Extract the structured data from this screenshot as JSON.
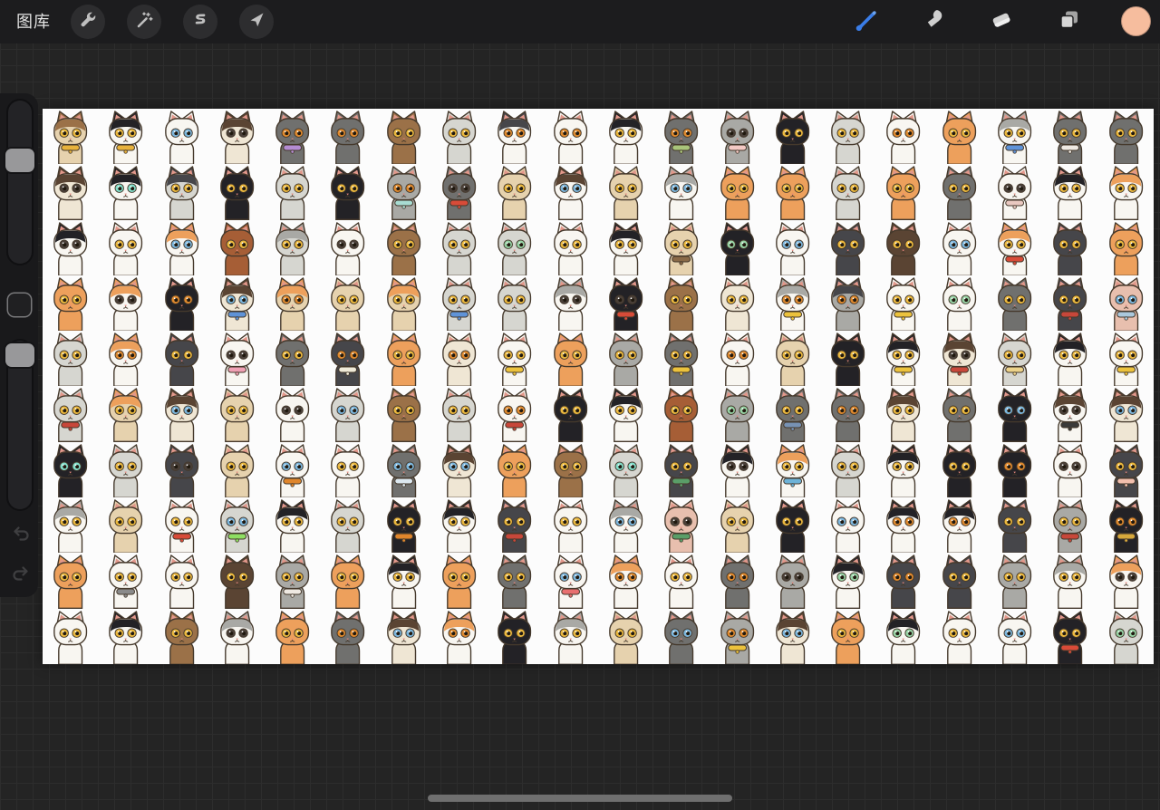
{
  "topbar": {
    "gallery_label": "图库"
  },
  "colors": {
    "accent": "#3a7de8",
    "swatch": "#f6bd9e",
    "topbar-bg": "#1c1c1e",
    "bg": "#242424",
    "grid-line": "#2d2d2d",
    "canvas-bg": "#fcfcfc",
    "icon": "#c4c4c4",
    "circle": "#2d2d2f",
    "panel": "#19191b",
    "track": "#232326",
    "handle": "#98989a",
    "indicator": "#6f6f6f"
  },
  "canvas": {
    "columns": 20,
    "rows": 10,
    "cat_count": 200
  },
  "cats": {
    "outline": "#45392c",
    "ear_inner": "#e2988b",
    "nose": "#e2857c",
    "palette": {
      "W": "#f8f6f1",
      "S": "#efe6d4",
      "C": "#e6d2ae",
      "L": "#d6d6d0",
      "G": "#a9a9a5",
      "D": "#70706e",
      "E": "#46464a",
      "B": "#232226",
      "O": "#eda05c",
      "T": "#9b7148",
      "N": "#5a4433",
      "R": "#a65e36",
      "P": "#e8bfae"
    },
    "eyes": {
      "y": "#ecb93e",
      "o": "#e08a2e",
      "b": "#7cb7de",
      "g": "#97d3a5",
      "t": "#83dfcb",
      "k": "#4a4039"
    },
    "items": [
      [
        "C",
        "y",
        "T",
        "#e8b23c"
      ],
      [
        "W",
        "y",
        "B",
        "#e8b23c"
      ],
      [
        "W",
        "b",
        null,
        null
      ],
      [
        "S",
        "k",
        "N",
        null
      ],
      [
        "D",
        "o",
        null,
        "#b48cd2"
      ],
      [
        "D",
        "o",
        null,
        null
      ],
      [
        "T",
        "y",
        null,
        null
      ],
      [
        "L",
        "y",
        null,
        null
      ],
      [
        "W",
        "o",
        "E",
        null
      ],
      [
        "W",
        "o",
        null,
        null
      ],
      [
        "W",
        "y",
        "B",
        null
      ],
      [
        "D",
        "o",
        null,
        "#a9c57a"
      ],
      [
        "G",
        "k",
        null,
        "#f4c9c4"
      ],
      [
        "B",
        "y",
        null,
        null
      ],
      [
        "L",
        "y",
        null,
        null
      ],
      [
        "W",
        "o",
        null,
        null
      ],
      [
        "O",
        "y",
        null,
        null
      ],
      [
        "W",
        "y",
        "G",
        "#5f93d8"
      ],
      [
        "D",
        "y",
        null,
        "#efe9e2"
      ],
      [
        "D",
        "y",
        null,
        null
      ],
      [
        "S",
        "k",
        "N",
        null
      ],
      [
        "W",
        "t",
        "B",
        null
      ],
      [
        "L",
        "y",
        "E",
        null
      ],
      [
        "B",
        "y",
        null,
        null
      ],
      [
        "L",
        "y",
        null,
        null
      ],
      [
        "B",
        "y",
        null,
        null
      ],
      [
        "G",
        "o",
        null,
        "#a8dcd2"
      ],
      [
        "D",
        "k",
        null,
        "#d84b38"
      ],
      [
        "C",
        "y",
        null,
        null
      ],
      [
        "W",
        "b",
        "N",
        null
      ],
      [
        "C",
        "y",
        null,
        null
      ],
      [
        "W",
        "b",
        "G",
        null
      ],
      [
        "O",
        "y",
        null,
        null
      ],
      [
        "O",
        "y",
        null,
        null
      ],
      [
        "L",
        "y",
        null,
        null
      ],
      [
        "O",
        "y",
        null,
        null
      ],
      [
        "D",
        "y",
        null,
        null
      ],
      [
        "W",
        "k",
        null,
        "#e9c8c0"
      ],
      [
        "W",
        "y",
        "B",
        null
      ],
      [
        "W",
        "y",
        "O",
        null
      ],
      [
        "W",
        "k",
        "B",
        null
      ],
      [
        "W",
        "y",
        null,
        null
      ],
      [
        "W",
        "b",
        "O",
        null
      ],
      [
        "R",
        "y",
        null,
        null
      ],
      [
        "L",
        "y",
        "G",
        null
      ],
      [
        "W",
        "k",
        null,
        null
      ],
      [
        "T",
        "y",
        null,
        null
      ],
      [
        "L",
        "y",
        null,
        null
      ],
      [
        "L",
        "g",
        null,
        null
      ],
      [
        "W",
        "y",
        null,
        null
      ],
      [
        "W",
        "y",
        "B",
        null
      ],
      [
        "C",
        "y",
        null,
        "#8a6a48"
      ],
      [
        "B",
        "g",
        null,
        null
      ],
      [
        "W",
        "b",
        null,
        null
      ],
      [
        "E",
        "y",
        null,
        null
      ],
      [
        "N",
        "y",
        null,
        null
      ],
      [
        "W",
        "b",
        null,
        null
      ],
      [
        "W",
        "y",
        "O",
        "#d84b38"
      ],
      [
        "E",
        "y",
        null,
        null
      ],
      [
        "O",
        "y",
        null,
        null
      ],
      [
        "O",
        "y",
        null,
        null
      ],
      [
        "W",
        "k",
        "O",
        null
      ],
      [
        "B",
        "o",
        null,
        null
      ],
      [
        "S",
        "b",
        "N",
        "#5f93d8"
      ],
      [
        "C",
        "o",
        "O",
        null
      ],
      [
        "C",
        "y",
        null,
        null
      ],
      [
        "C",
        "y",
        "O",
        null
      ],
      [
        "L",
        "y",
        null,
        "#5f93d8"
      ],
      [
        "L",
        "y",
        null,
        null
      ],
      [
        "W",
        "k",
        "G",
        null
      ],
      [
        "B",
        "k",
        null,
        "#d84b38"
      ],
      [
        "T",
        "y",
        null,
        null
      ],
      [
        "S",
        "y",
        null,
        null
      ],
      [
        "W",
        "o",
        "G",
        "#ecc23c"
      ],
      [
        "G",
        "o",
        "E",
        null
      ],
      [
        "W",
        "y",
        null,
        "#ecc23c"
      ],
      [
        "W",
        "g",
        null,
        null
      ],
      [
        "D",
        "y",
        null,
        null
      ],
      [
        "E",
        "y",
        null,
        "#c8473a"
      ],
      [
        "P",
        "b",
        null,
        "#aac8dc"
      ],
      [
        "L",
        "y",
        null,
        null
      ],
      [
        "W",
        "o",
        "O",
        null
      ],
      [
        "E",
        "y",
        null,
        null
      ],
      [
        "W",
        "k",
        null,
        "#f0a0b4"
      ],
      [
        "D",
        "y",
        null,
        null
      ],
      [
        "E",
        "o",
        null,
        "#f0ead8"
      ],
      [
        "O",
        "y",
        null,
        null
      ],
      [
        "S",
        "o",
        null,
        null
      ],
      [
        "W",
        "y",
        null,
        "#ecc23c"
      ],
      [
        "O",
        "y",
        null,
        null
      ],
      [
        "G",
        "y",
        null,
        null
      ],
      [
        "D",
        "y",
        null,
        "#ecc23c"
      ],
      [
        "W",
        "o",
        null,
        null
      ],
      [
        "C",
        "y",
        null,
        null
      ],
      [
        "B",
        "y",
        null,
        null
      ],
      [
        "W",
        "y",
        "B",
        "#ecc23c"
      ],
      [
        "S",
        "k",
        "N",
        "#c8473a"
      ],
      [
        "L",
        "y",
        null,
        "#ecd28a"
      ],
      [
        "W",
        "y",
        "B",
        null
      ],
      [
        "W",
        "y",
        null,
        "#ecc23c"
      ],
      [
        "L",
        "y",
        null,
        "#c8473a"
      ],
      [
        "C",
        "y",
        "O",
        null
      ],
      [
        "S",
        "b",
        "N",
        null
      ],
      [
        "C",
        "y",
        null,
        null
      ],
      [
        "W",
        "k",
        null,
        null
      ],
      [
        "L",
        "b",
        null,
        null
      ],
      [
        "T",
        "y",
        null,
        null
      ],
      [
        "L",
        "y",
        null,
        null
      ],
      [
        "W",
        "o",
        null,
        "#c8473a"
      ],
      [
        "B",
        "y",
        null,
        null
      ],
      [
        "W",
        "y",
        "B",
        null
      ],
      [
        "R",
        "y",
        null,
        null
      ],
      [
        "G",
        "g",
        null,
        null
      ],
      [
        "D",
        "y",
        null,
        "#7792b4"
      ],
      [
        "D",
        "o",
        null,
        null
      ],
      [
        "S",
        "y",
        "N",
        null
      ],
      [
        "D",
        "y",
        null,
        null
      ],
      [
        "B",
        "b",
        null,
        null
      ],
      [
        "W",
        "k",
        "N",
        "#3a3a3a"
      ],
      [
        "S",
        "b",
        "N",
        null
      ],
      [
        "B",
        "t",
        null,
        null
      ],
      [
        "L",
        "y",
        null,
        null
      ],
      [
        "E",
        "k",
        null,
        null
      ],
      [
        "C",
        "y",
        null,
        null
      ],
      [
        "W",
        "b",
        null,
        "#e0862c"
      ],
      [
        "W",
        "y",
        null,
        null
      ],
      [
        "D",
        "b",
        null,
        "#dce8f0"
      ],
      [
        "S",
        "b",
        "N",
        null
      ],
      [
        "O",
        "y",
        null,
        null
      ],
      [
        "T",
        "y",
        null,
        null
      ],
      [
        "L",
        "t",
        null,
        null
      ],
      [
        "E",
        "y",
        null,
        "#5a9e68"
      ],
      [
        "W",
        "k",
        "B",
        null
      ],
      [
        "W",
        "y",
        "O",
        "#6db3d8"
      ],
      [
        "L",
        "y",
        null,
        null
      ],
      [
        "W",
        "y",
        "B",
        null
      ],
      [
        "B",
        "y",
        null,
        null
      ],
      [
        "B",
        "o",
        null,
        null
      ],
      [
        "W",
        "k",
        null,
        null
      ],
      [
        "E",
        "y",
        null,
        "#f2bfae"
      ],
      [
        "W",
        "y",
        "G",
        null
      ],
      [
        "C",
        "y",
        null,
        null
      ],
      [
        "W",
        "y",
        null,
        "#d84b38"
      ],
      [
        "L",
        "b",
        null,
        "#8ede62"
      ],
      [
        "W",
        "y",
        "B",
        null
      ],
      [
        "L",
        "y",
        null,
        null
      ],
      [
        "B",
        "y",
        null,
        "#e0862c"
      ],
      [
        "W",
        "y",
        "B",
        null
      ],
      [
        "E",
        "y",
        null,
        "#c8473a"
      ],
      [
        "W",
        "y",
        null,
        null
      ],
      [
        "W",
        "b",
        "G",
        null
      ],
      [
        "P",
        "k",
        null,
        "#5a9e68"
      ],
      [
        "C",
        "y",
        null,
        null
      ],
      [
        "B",
        "y",
        null,
        null
      ],
      [
        "W",
        "b",
        null,
        null
      ],
      [
        "W",
        "o",
        "B",
        null
      ],
      [
        "W",
        "o",
        "B",
        null
      ],
      [
        "E",
        "y",
        null,
        null
      ],
      [
        "G",
        "y",
        null,
        "#c8473a"
      ],
      [
        "B",
        "o",
        null,
        "#d8a93c"
      ],
      [
        "O",
        "y",
        null,
        null
      ],
      [
        "W",
        "y",
        null,
        "#8a8a8a"
      ],
      [
        "W",
        "y",
        null,
        null
      ],
      [
        "N",
        "y",
        null,
        null
      ],
      [
        "G",
        "y",
        null,
        "#efe9e2"
      ],
      [
        "O",
        "y",
        null,
        null
      ],
      [
        "W",
        "y",
        "B",
        null
      ],
      [
        "O",
        "y",
        null,
        null
      ],
      [
        "D",
        "y",
        null,
        null
      ],
      [
        "W",
        "b",
        null,
        "#e87070"
      ],
      [
        "W",
        "o",
        "O",
        null
      ],
      [
        "W",
        "y",
        null,
        null
      ],
      [
        "D",
        "o",
        null,
        null
      ],
      [
        "G",
        "k",
        null,
        null
      ],
      [
        "W",
        "g",
        "B",
        null
      ],
      [
        "E",
        "o",
        null,
        null
      ],
      [
        "E",
        "y",
        null,
        null
      ],
      [
        "G",
        "y",
        null,
        null
      ],
      [
        "W",
        "y",
        "G",
        null
      ],
      [
        "W",
        "k",
        "O",
        null
      ],
      [
        "W",
        "y",
        null,
        null
      ],
      [
        "W",
        "y",
        "B",
        null
      ],
      [
        "T",
        "y",
        null,
        null
      ],
      [
        "W",
        "k",
        "G",
        null
      ],
      [
        "O",
        "y",
        null,
        null
      ],
      [
        "D",
        "o",
        null,
        null
      ],
      [
        "S",
        "b",
        "N",
        null
      ],
      [
        "W",
        "o",
        "O",
        null
      ],
      [
        "B",
        "y",
        null,
        null
      ],
      [
        "W",
        "y",
        "G",
        null
      ],
      [
        "C",
        "y",
        null,
        null
      ],
      [
        "D",
        "b",
        null,
        null
      ],
      [
        "G",
        "o",
        null,
        "#ecc23c"
      ],
      [
        "S",
        "b",
        "N",
        null
      ],
      [
        "O",
        "y",
        null,
        null
      ],
      [
        "W",
        "g",
        "B",
        null
      ],
      [
        "W",
        "y",
        null,
        null
      ],
      [
        "W",
        "b",
        null,
        null
      ],
      [
        "B",
        "y",
        null,
        "#d84b38"
      ],
      [
        "L",
        "g",
        null,
        null
      ]
    ]
  }
}
